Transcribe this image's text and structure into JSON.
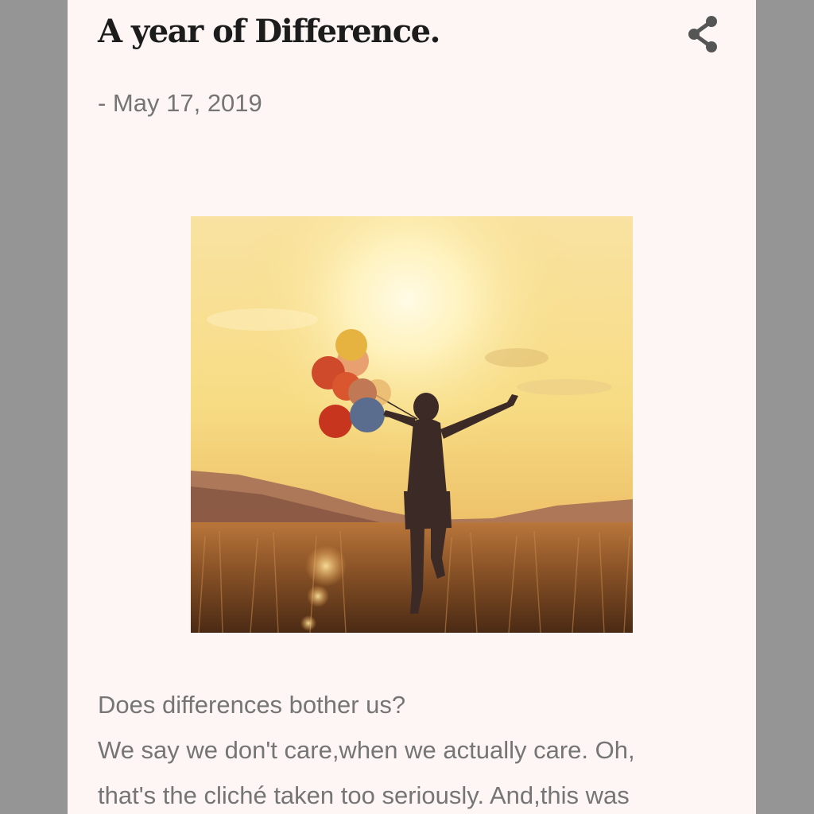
{
  "post": {
    "title": "A year of Difference.",
    "date": "- May 17, 2019",
    "share_icon": "share-icon",
    "image": {
      "subject": "girl-running-with-balloons-at-sunset",
      "accent_sky": "#f6d98a",
      "accent_field": "#7a4a22"
    },
    "body_lines": [
      "Does differences bother us?",
      "We say we don't care,when we actually care. Oh,",
      "that's the cliché taken too seriously. And,this was"
    ]
  },
  "colors": {
    "page_background": "#959595",
    "card_background": "#fdf6f4",
    "title_text": "#1c1c1c",
    "muted_text": "#757575"
  }
}
